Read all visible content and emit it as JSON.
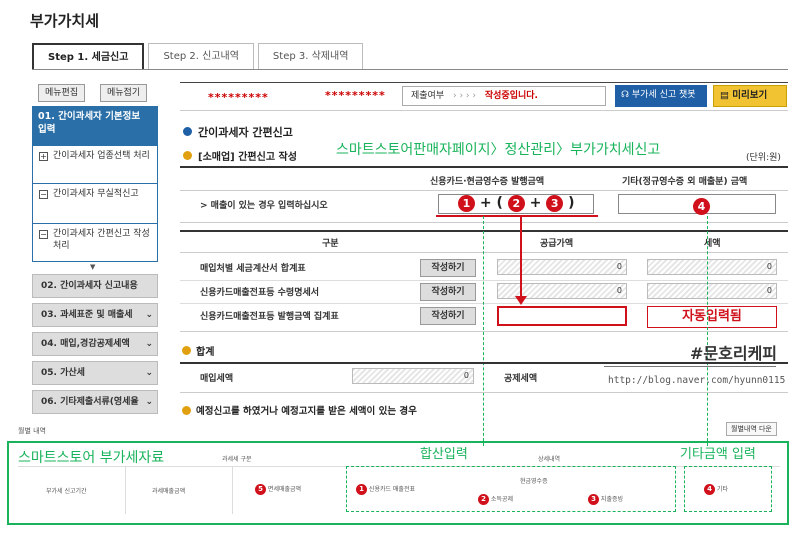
{
  "page_title": "부가가치세",
  "tabs": [
    "Step 1. 세금신고",
    "Step 2. 신고내역",
    "Step 3. 삭제내역"
  ],
  "sidebar": {
    "edit_btn": "메뉴편집",
    "fold_btn": "메뉴접기",
    "main_item": "01. 간이과세자 기본정보 입력",
    "sub_items": [
      "간이과세자 업종선택 처리",
      "간이과세자 무실적신고",
      "간이과세자 간편신고 작성 처리"
    ],
    "grey_items": [
      "02. 간이과세자 신고내용",
      "03. 과세표준 및 매출세",
      "04. 매입,경감공제세액",
      "05. 가산세",
      "06. 기타제출서류(영세율"
    ]
  },
  "topbar": {
    "stars1": "*********",
    "stars2": "*********",
    "submit_label": "제출여부",
    "arrows": "› › › ›",
    "status": "작성중입니다.",
    "chatbot_btn": "부가세 신고 챗봇",
    "preview_btn": "미리보기"
  },
  "section": {
    "title": "간이과세자 간편신고",
    "sub": "[소매업] 간편신고 작성",
    "annotation": "스마트스토어판매자페이지〉정산관리〉부가가치세신고",
    "unit": "(단위:원)"
  },
  "sales_table": {
    "col1": "신용카드·현금영수증 발행금액",
    "col2": "기타(정규영수증 외 매출분) 금액",
    "row_label": "> 매출이 있는 경우 입력하십시오",
    "formula": [
      "1",
      "+ (",
      "2",
      "+",
      "3",
      ")"
    ],
    "right_marker": "4"
  },
  "purchase_table": {
    "col_gubun": "구분",
    "col_supply": "공급가액",
    "col_tax": "세액",
    "rows": [
      {
        "label": "매입처별 세금계산서 합계표",
        "btn": "작성하기",
        "supply": "0",
        "tax": "0"
      },
      {
        "label": "신용카드매출전표등 수령명세서",
        "btn": "작성하기",
        "supply": "0",
        "tax": "0"
      },
      {
        "label": "신용카드매출전표등 발행금액 집계표",
        "btn": "작성하기",
        "supply": "",
        "tax": ""
      }
    ],
    "auto_note": "자동입력됨"
  },
  "summary": {
    "title": "합계",
    "input_tax_label": "매입세액",
    "input_tax": "0",
    "deduct_label": "공제세액",
    "hashtag": "#문호리케피",
    "blog": "http://blog.naver.com/hyunn0115"
  },
  "notice": "예정신고를 하였거나 예정고지를 받은 세액이 있는 경우",
  "monthly": {
    "label": "월별 내역",
    "download": "월별내역 다운",
    "store_title": "스마트스토어 부가세자료",
    "sum_input": "합산입력",
    "other_input": "기타금액 입력",
    "tax_type": "과세세 구분",
    "detail": "상세내역",
    "period": "부가세 신고기간",
    "taxable_sales": "과세매출금액",
    "exempt_sales": "면세매출금액",
    "card": "신용카드 매출전표",
    "cash_receipt": "현금영수증",
    "income_deduct": "소득공제",
    "expense_proof": "지출증빙",
    "other": "기타",
    "markers": [
      "5",
      "1",
      "2",
      "3",
      "4"
    ]
  }
}
